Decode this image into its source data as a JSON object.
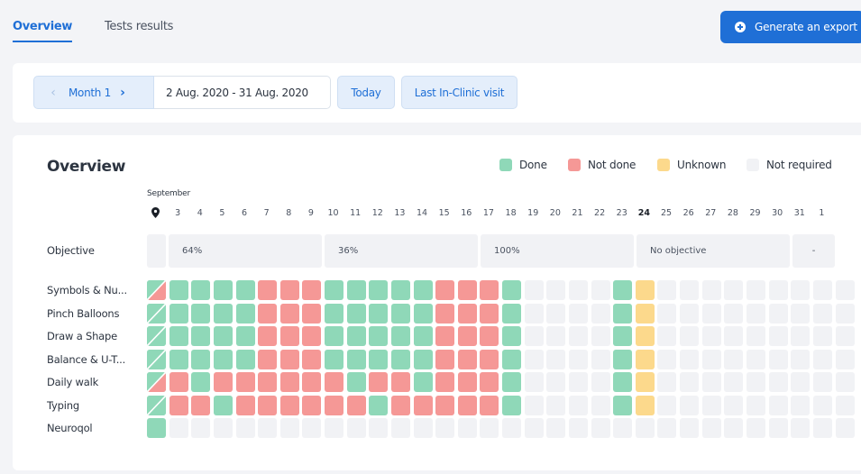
{
  "tabs": [
    {
      "label": "Overview",
      "active": true
    },
    {
      "label": "Tests results",
      "active": false
    }
  ],
  "export_button": {
    "label": "Generate an export",
    "icon": "plus-circle-icon"
  },
  "date_controls": {
    "month_label": "Month 1",
    "prev_icon": "chevron-left-icon",
    "next_icon": "chevron-right-icon",
    "date_range": "2 Aug. 2020 - 31 Aug. 2020",
    "today_label": "Today",
    "last_visit_label": "Last In-Clinic visit"
  },
  "overview": {
    "title": "Overview",
    "legend": [
      {
        "label": "Done",
        "color": "#8fd8b8"
      },
      {
        "label": "Not done",
        "color": "#f59896"
      },
      {
        "label": "Unknown",
        "color": "#fcd98c"
      },
      {
        "label": "Not required",
        "color": "#f1f2f5"
      }
    ],
    "month_name": "September",
    "days": [
      "3",
      "4",
      "5",
      "6",
      "7",
      "8",
      "9",
      "10",
      "11",
      "12",
      "13",
      "14",
      "15",
      "16",
      "17",
      "18",
      "19",
      "20",
      "21",
      "22",
      "23",
      "24",
      "25",
      "26",
      "27",
      "28",
      "29",
      "30",
      "31",
      "1"
    ],
    "today_day": "24",
    "objective": {
      "label": "Objective",
      "segments": [
        {
          "text": ""
        },
        {
          "text": "64%"
        },
        {
          "text": "36%"
        },
        {
          "text": "100%"
        },
        {
          "text": "No objective"
        },
        {
          "text": "-"
        }
      ]
    },
    "status_colors": {
      "D": "#8fd8b8",
      "N": "#f59896",
      "U": "#fcd98c",
      "E": "#f1f2f5"
    },
    "rows": [
      {
        "label": "Symbols & Nu...",
        "first": "mixed-notdone",
        "cells": "DDDDNNNDDDDDNNNDEEEEDUEEEEEEEEE"
      },
      {
        "label": "Pinch Balloons",
        "first": "mixed-done",
        "cells": "DDDDNNNDDDDDNNNDEEEEDUEEEEEEEEE"
      },
      {
        "label": "Draw a Shape",
        "first": "mixed-done",
        "cells": "DDDDNNNDDDDDNNNDEEEEDUEEEEEEEEE"
      },
      {
        "label": "Balance & U-T...",
        "first": "mixed-done",
        "cells": "DDDDNNNDDDDDNNNDEEEEDUEEEEEEEEE"
      },
      {
        "label": "Daily walk",
        "first": "mixed-notdone",
        "cells": "NDNNNNNNDNNDNNNDEEEEDUEEEEEEEEE"
      },
      {
        "label": "Typing",
        "first": "mixed-done",
        "cells": "NNDNNNNNNDNNNNNDEEEEDUEEEEEEEEE"
      },
      {
        "label": "Neuroqol",
        "first": "done",
        "cells": "EEEEEEEEEEEEEEEEEEEEEEEEEEEEEEE"
      }
    ]
  }
}
